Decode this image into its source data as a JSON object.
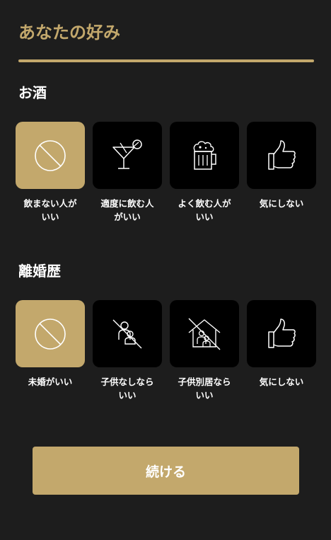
{
  "page": {
    "title": "あなたの好み"
  },
  "colors": {
    "background": "#1d1d1d",
    "accent": "#c3a86c",
    "tile": "#000000",
    "text": "#ffffff"
  },
  "sections": [
    {
      "title": "お酒",
      "options": [
        {
          "label": "飲まない人が\nいい",
          "icon": "prohibited-icon",
          "selected": true
        },
        {
          "label": "適度に飲む人\nがいい",
          "icon": "cocktail-glass-icon",
          "selected": false
        },
        {
          "label": "よく飲む人が\nいい",
          "icon": "beer-mug-icon",
          "selected": false
        },
        {
          "label": "気にしない",
          "icon": "thumbs-up-icon",
          "selected": false
        }
      ]
    },
    {
      "title": "離婚歴",
      "options": [
        {
          "label": "未婚がいい",
          "icon": "prohibited-icon",
          "selected": true
        },
        {
          "label": "子供なしなら\nいい",
          "icon": "no-children-icon",
          "selected": false
        },
        {
          "label": "子供別居なら\nいい",
          "icon": "children-separate-house-icon",
          "selected": false
        },
        {
          "label": "気にしない",
          "icon": "thumbs-up-icon",
          "selected": false
        }
      ]
    }
  ],
  "continue_button": {
    "label": "続ける"
  }
}
